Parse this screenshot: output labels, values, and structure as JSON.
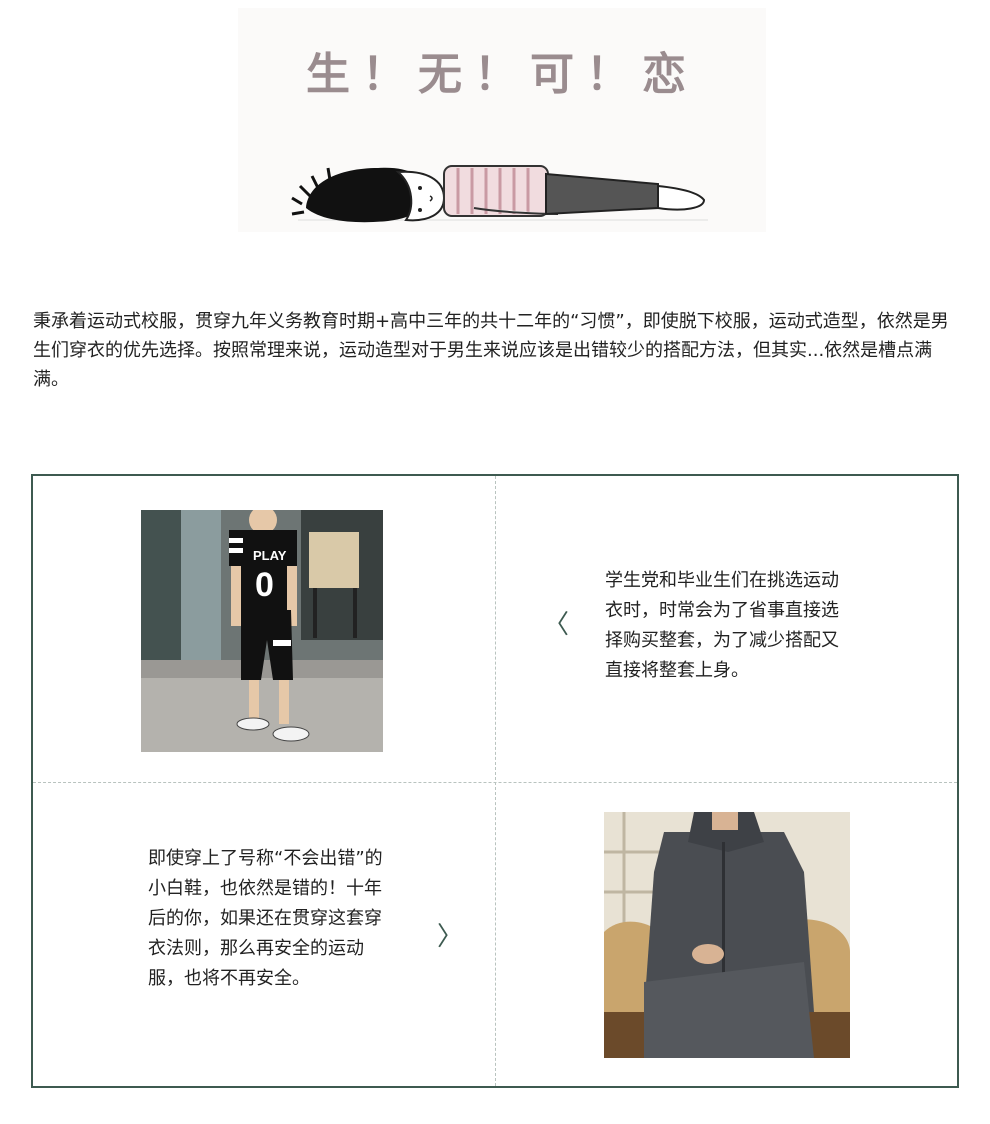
{
  "hero": {
    "title": "生！无！可！恋"
  },
  "intro": {
    "text": "秉承着运动式校服，贯穿九年义务教育时期+高中三年的共十二年的“习惯”，即使脱下校服，运动式造型，依然是男生们穿衣的优先选择。按照常理来说，运动造型对于男生来说应该是出错较少的搭配方法，但其实...依然是槽点满满。"
  },
  "grid": {
    "border_color": "#3d5a50",
    "top_right": {
      "arrow_icon": "chevron-left-icon",
      "arrow_glyph": "〈",
      "caption": "学生党和毕业生们在挑选运动衣时，时常会为了省事直接选择购买整套，为了减少搭配又直接将整套上身。"
    },
    "bottom_left": {
      "arrow_icon": "chevron-right-icon",
      "arrow_glyph": "〉",
      "caption": "即使穿上了号称“不会出错”的小白鞋，也依然是错的！十年后的你，如果还在贯穿这套穿衣法则，那么再安全的运动服，也将不再安全。"
    },
    "photo1": {
      "jersey_text": "PLAY",
      "jersey_number": "0"
    }
  }
}
